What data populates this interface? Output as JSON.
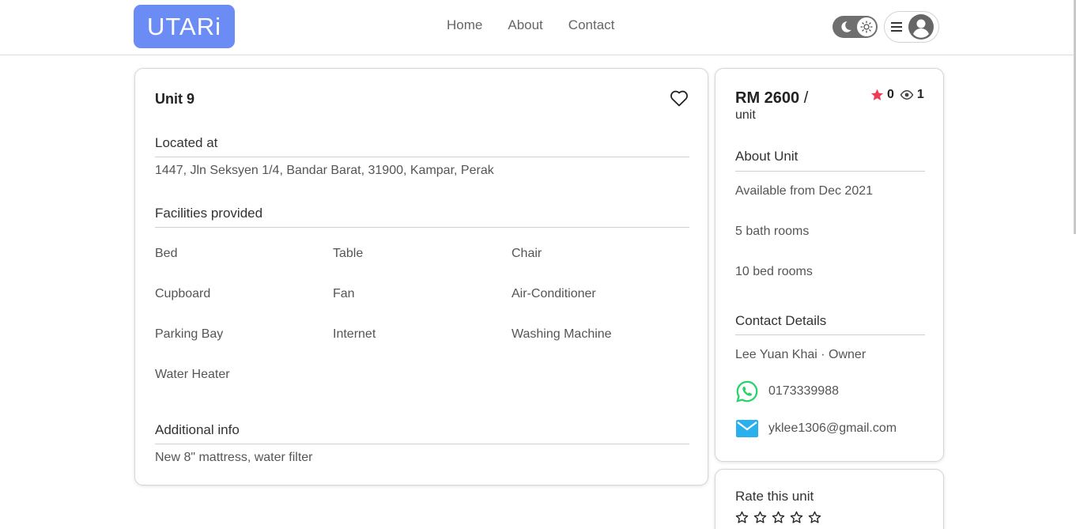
{
  "header": {
    "logo": "UTARi",
    "nav": [
      "Home",
      "About",
      "Contact"
    ]
  },
  "unit": {
    "title": "Unit 9",
    "located_heading": "Located at",
    "address": "1447, Jln Seksyen 1/4, Bandar Barat, 31900, Kampar, Perak",
    "facilities_heading": "Facilities provided",
    "facilities": [
      "Bed",
      "Table",
      "Chair",
      "Cupboard",
      "Fan",
      "Air-Conditioner",
      "Parking Bay",
      "Internet",
      "Washing Machine",
      "Water Heater"
    ],
    "additional_heading": "Additional info",
    "additional_info": "New 8\" mattress, water filter"
  },
  "sidebar": {
    "price": "RM 2600",
    "price_sep": "/",
    "price_unit": "unit",
    "rating": "0",
    "views": "1",
    "about_heading": "About Unit",
    "available": "Available from Dec 2021",
    "bathrooms": "5 bath rooms",
    "bedrooms": "10 bed rooms",
    "contact_heading": "Contact Details",
    "owner": "Lee Yuan Khai · Owner",
    "phone": "0173339988",
    "email": "yklee1306@gmail.com"
  },
  "rate": {
    "heading": "Rate this unit",
    "selected_stars": 0,
    "max_stars": 5
  },
  "colors": {
    "logo_bg": "#6b8cf5",
    "star_red": "#ef3b55",
    "whatsapp_green": "#25d366",
    "mail_blue": "#2bb0ee"
  }
}
